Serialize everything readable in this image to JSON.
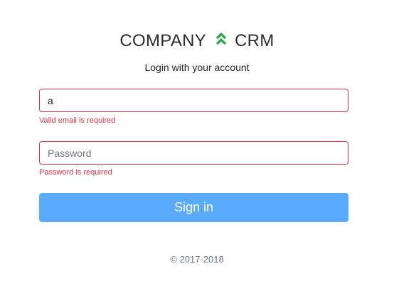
{
  "brand": {
    "left": "COMPANY",
    "right": "CRM",
    "logo_icon": "double-chevron-up-icon",
    "logo_color": "#28a745"
  },
  "subtitle": "Login with your account",
  "email": {
    "value": "a",
    "error": "Valid email is required"
  },
  "password": {
    "value": "",
    "placeholder": "Password",
    "error": "Password is required"
  },
  "signin_label": "Sign in",
  "footer": "© 2017-2018",
  "colors": {
    "error": "#dc3545",
    "button": "#5aabff"
  }
}
